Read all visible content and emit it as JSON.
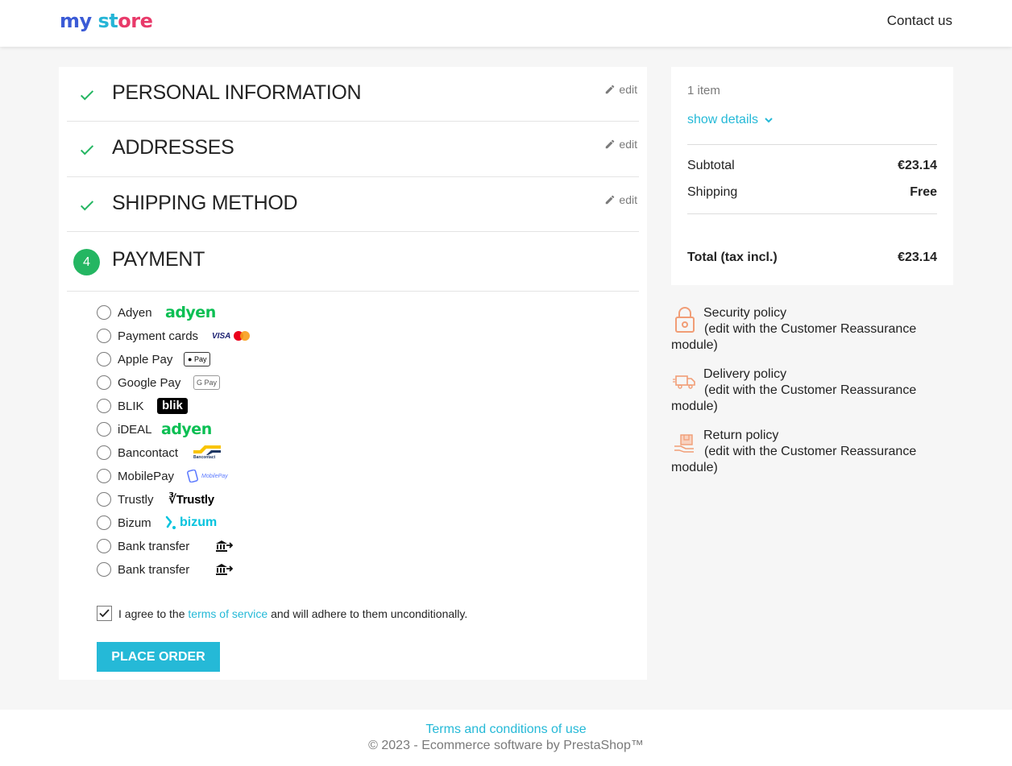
{
  "header": {
    "logo_parts": [
      "my",
      " ",
      "st",
      "ore"
    ],
    "contact": "Contact us"
  },
  "steps": [
    {
      "title": "Personal Information",
      "edit": "edit",
      "status": "complete"
    },
    {
      "title": "Addresses",
      "edit": "edit",
      "status": "complete"
    },
    {
      "title": "Shipping Method",
      "edit": "edit",
      "status": "complete"
    },
    {
      "title": "Payment",
      "number": "4",
      "status": "current"
    }
  ],
  "payment": {
    "options": [
      {
        "label": "Adyen",
        "logo": "adyen-logo"
      },
      {
        "label": "Payment cards",
        "logo": "visa-mastercard-logo"
      },
      {
        "label": "Apple Pay",
        "logo": "apple-pay-logo"
      },
      {
        "label": "Google Pay",
        "logo": "google-pay-logo"
      },
      {
        "label": "BLIK",
        "logo": "blik-logo"
      },
      {
        "label": "iDEAL",
        "logo": "adyen-logo"
      },
      {
        "label": "Bancontact",
        "logo": "bancontact-logo"
      },
      {
        "label": "MobilePay",
        "logo": "mobilepay-logo"
      },
      {
        "label": "Trustly",
        "logo": "trustly-logo"
      },
      {
        "label": "Bizum",
        "logo": "bizum-logo"
      },
      {
        "label": "Bank transfer",
        "logo": "bank-transfer-icon"
      },
      {
        "label": "Bank transfer",
        "logo": "bank-transfer-icon"
      }
    ],
    "logo_text": {
      "adyen": "adyen",
      "visa": "VISA",
      "applepay": "Pay",
      "googlepay": "G Pay",
      "blik": "blik",
      "bancontact": "Bancontact",
      "mobilepay": "MobilePay",
      "trustly": "Trustly",
      "bizum": "bizum"
    },
    "terms": {
      "before": "I agree to the ",
      "link": "terms of service",
      "after": " and will adhere to them unconditionally.",
      "checked": true
    },
    "place_order": "Place order"
  },
  "summary": {
    "items": "1 item",
    "show_details": "show details",
    "subtotal_label": "Subtotal",
    "subtotal_value": "€23.14",
    "shipping_label": "Shipping",
    "shipping_value": "Free",
    "total_label": "Total (tax incl.)",
    "total_value": "€23.14"
  },
  "reassurance": [
    {
      "title": "Security policy",
      "desc": "(edit with the Customer Reassurance module)",
      "icon": "lock-icon"
    },
    {
      "title": "Delivery policy",
      "desc": "(edit with the Customer Reassurance module)",
      "icon": "truck-icon"
    },
    {
      "title": "Return policy",
      "desc": "(edit with the Customer Reassurance module)",
      "icon": "return-box-icon"
    }
  ],
  "footer": {
    "terms_link": "Terms and conditions of use",
    "copyright": "© 2023 - Ecommerce software by PrestaShop™"
  },
  "colors": {
    "accent": "#25b9d7",
    "success": "#24b662",
    "background": "#f6f6f6",
    "text": "#232323",
    "muted": "#7a7a7a"
  }
}
